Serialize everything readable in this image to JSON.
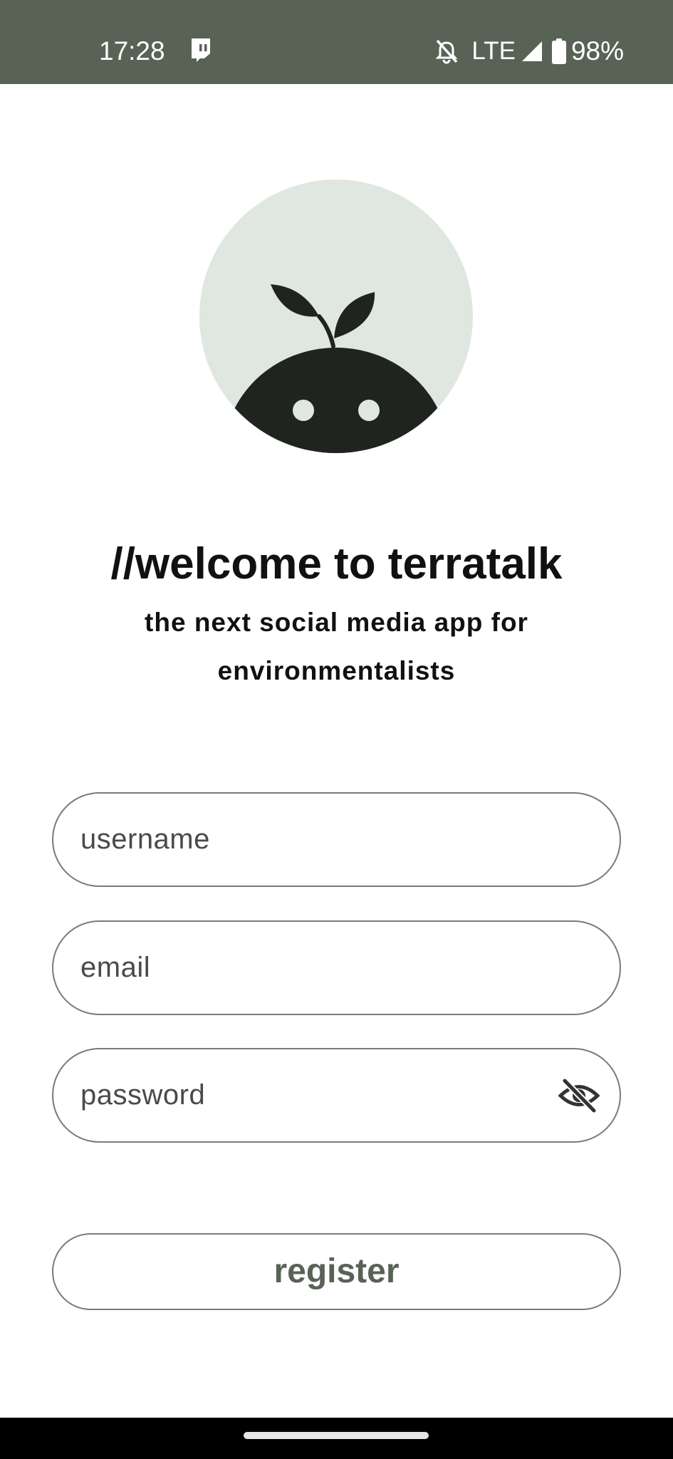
{
  "status_bar": {
    "time": "17:28",
    "network": "LTE",
    "battery": "98%",
    "icons": [
      "twitch-icon",
      "notifications-off-icon",
      "signal-icon",
      "battery-icon"
    ]
  },
  "logo": {
    "icon": "sprout-mascot-logo"
  },
  "welcome": {
    "title": "//welcome to terratalk",
    "subtitle": "the next social media app for environmentalists"
  },
  "form": {
    "username_placeholder": "username",
    "email_placeholder": "email",
    "password_placeholder": "password",
    "password_toggle_icon": "eye-off-icon"
  },
  "register": {
    "label": "register"
  },
  "colors": {
    "accent": "#586356",
    "logo_bg": "#dfe7e0",
    "logo_dark": "#1f251e"
  }
}
